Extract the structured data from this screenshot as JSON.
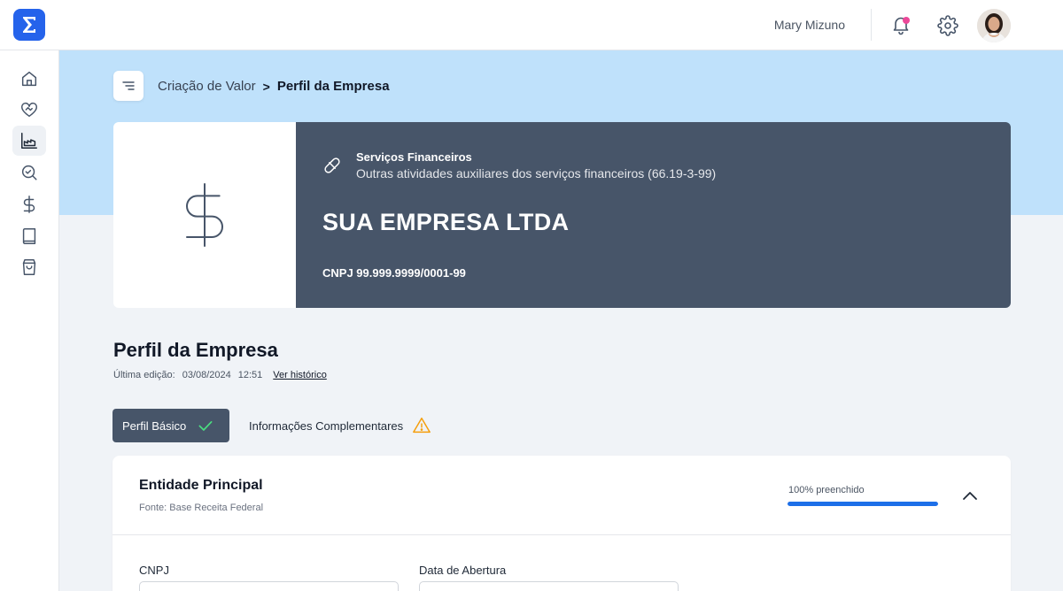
{
  "header": {
    "user_name": "Mary Mizuno",
    "has_notification": true
  },
  "sidebar": {
    "items": [
      {
        "icon": "home-icon",
        "active": false
      },
      {
        "icon": "heart-handshake-icon",
        "active": false
      },
      {
        "icon": "factory-chart-icon",
        "active": true
      },
      {
        "icon": "search-check-icon",
        "active": false
      },
      {
        "icon": "dollar-icon",
        "active": false
      },
      {
        "icon": "book-icon",
        "active": false
      },
      {
        "icon": "shopping-bag-icon",
        "active": false
      }
    ]
  },
  "breadcrumb": {
    "parent": "Criação de Valor",
    "separator": ">",
    "current": "Perfil da Empresa"
  },
  "company": {
    "sector_title": "Serviços Financeiros",
    "sector_sub": "Outras atividades auxiliares dos serviços financeiros (66.19-3-99)",
    "name": "SUA EMPRESA LTDA",
    "cnpj": "CNPJ 99.999.9999/0001-99"
  },
  "profile": {
    "title": "Perfil da Empresa",
    "last_edit_label": "Última edição:",
    "last_edit_date": "03/08/2024",
    "last_edit_time": "12:51",
    "history_link": "Ver histórico"
  },
  "tabs": [
    {
      "label": "Perfil Básico",
      "status": "complete"
    },
    {
      "label": "Informações Complementares",
      "status": "warning"
    }
  ],
  "section": {
    "title": "Entidade Principal",
    "source": "Fonte: Base Receita Federal",
    "progress_label": "100% preenchido",
    "progress": 1.0,
    "fields": [
      {
        "label": "CNPJ",
        "value": ""
      },
      {
        "label": "Data de Abertura",
        "value": ""
      }
    ]
  },
  "colors": {
    "primary": "#2563eb",
    "hero": "#bfe1fb",
    "card_dark": "#475569",
    "progress": "#1d6fe8",
    "success": "#4ade80",
    "warning": "#f59e0b",
    "notification": "#ec4899"
  }
}
